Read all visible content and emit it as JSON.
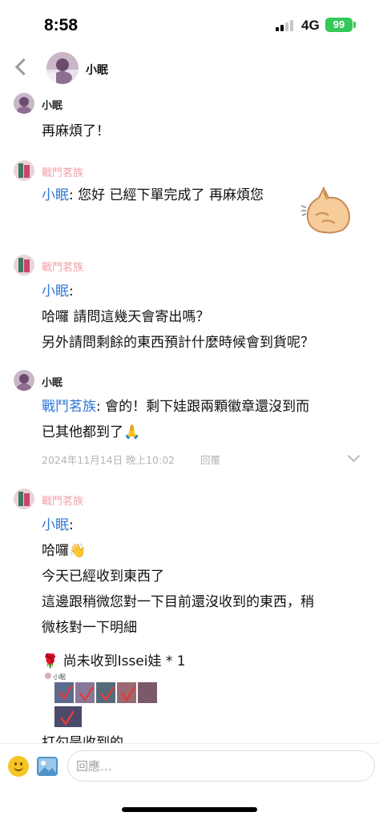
{
  "status_bar": {
    "time": "8:58",
    "network": "4G",
    "battery": "99"
  },
  "header": {
    "back_icon": "chevron-left-icon",
    "contact_name": "小眠"
  },
  "colors": {
    "mention": "#2f78d6",
    "sender_pink": "#f2a0a4",
    "battery": "#34c759",
    "meta": "#b4b4b4"
  },
  "messages": [
    {
      "sender": "小眠",
      "lines": [
        "再麻煩了！"
      ]
    },
    {
      "sender": "戰鬥茗族",
      "mention": "小眠",
      "lines": [
        ": 您好 已經下單完成了 再麻煩您"
      ],
      "sticker": "cat-paw-sticker"
    },
    {
      "sender": "戰鬥茗族",
      "mention": "小眠",
      "lines": [
        ":",
        "哈囉 請問這幾天會寄出嗎？",
        "另外請問剩餘的東西預計什麼時候會到貨呢？"
      ]
    },
    {
      "sender": "小眠",
      "mention": "戰鬥茗族",
      "lines": [
        ": 會的！剩下娃跟兩顆徽章還沒到而",
        "已其他都到了🙏"
      ],
      "timestamp": "2024年11月14日 晚上10:02",
      "reply_label": "回覆"
    },
    {
      "sender": "戰鬥茗族",
      "mention": "小眠",
      "lines": [
        ":",
        "哈囉👋",
        "今天已經收到東西了",
        "這邊跟稍微您對一下目前還沒收到的東西，稍",
        "微核對一下明細",
        "",
        "🌹 尚未收到Issei娃 * 1"
      ],
      "image_caption": "小眠",
      "cut_line": "打勾是收到的"
    }
  ],
  "composer": {
    "placeholder": "回應..."
  }
}
